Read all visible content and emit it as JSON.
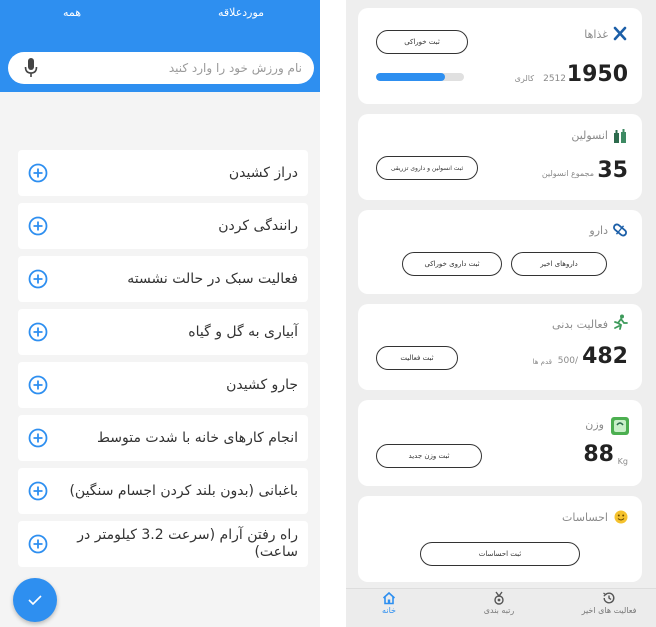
{
  "left_screen": {
    "tabs": {
      "all": "همه",
      "favorites": "موردعلاقه"
    },
    "search": {
      "placeholder": "نام ورزش خود را وارد کنید"
    },
    "activities": [
      "دراز کشیدن",
      "رانندگی کردن",
      "فعالیت سبک در حالت نشسته",
      "آبیاری به گل و گیاه",
      "جارو کشیدن",
      "انجام کارهای خانه با شدت متوسط",
      "باغبانی (بدون بلند کردن اجسام سنگین)",
      "راه رفتن آرام (سرعت 3.2 کیلومتر در ساعت)"
    ]
  },
  "right_screen": {
    "food": {
      "title": "غذاها",
      "button": "ثبت خوراکی",
      "value": "1950",
      "goal": "2512",
      "unit": "کالری",
      "progress": 0.78
    },
    "insulin": {
      "title": "انسولین",
      "button": "ثبت انسولین و داروی تزریقی",
      "value": "35",
      "label": "مجموع انسولین"
    },
    "medicine": {
      "title": "دارو",
      "button_recent": "داروهای اخیر",
      "button_oral": "ثبت داروی خوراکی"
    },
    "activity": {
      "title": "فعالیت بدنی",
      "button": "ثبت فعالیت",
      "value": "482",
      "goal": "/500",
      "unit": "قدم ها"
    },
    "weight": {
      "title": "وزن",
      "button": "ثبت وزن جدید",
      "value": "88",
      "unit": "Kg"
    },
    "feelings": {
      "title": "احساسات",
      "button": "ثبت احساسات"
    },
    "nav": {
      "home": "خانه",
      "ranking": "رتبه بندی",
      "recent": "فعالیت های اخیر"
    }
  },
  "colors": {
    "primary": "#2e8ff0",
    "background": "#eeeeee",
    "text": "#222222"
  },
  "icons": [
    "mic-icon",
    "plus-circle-icon",
    "check-icon",
    "utensils-icon",
    "insulin-icon",
    "pill-icon",
    "running-icon",
    "scale-icon",
    "smile-icon",
    "home-icon",
    "medal-icon",
    "history-icon"
  ]
}
